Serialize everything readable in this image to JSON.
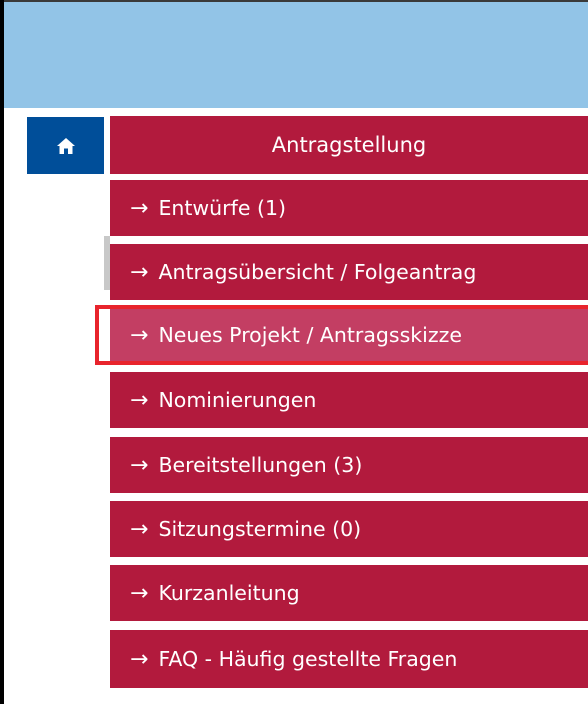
{
  "colors": {
    "header_blue": "#92c4e7",
    "home_blue": "#004e99",
    "menu_red": "#b21a3d",
    "menu_active": "#c33e63",
    "highlight_red": "#e8242c"
  },
  "home": {
    "icon": "home-icon"
  },
  "menu": {
    "title": "Antragstellung",
    "arrow_glyph": "→",
    "items": [
      {
        "label": "Entwürfe (1)"
      },
      {
        "label": "Antragsübersicht / Folgeantrag"
      },
      {
        "label": "Neues Projekt / Antragsskizze",
        "active": true
      },
      {
        "label": "Nominierungen"
      },
      {
        "label": "Bereitstellungen (3)"
      },
      {
        "label": "Sitzungstermine (0)"
      },
      {
        "label": "Kurzanleitung"
      },
      {
        "label": "FAQ - Häufig gestellte Fragen"
      }
    ]
  }
}
